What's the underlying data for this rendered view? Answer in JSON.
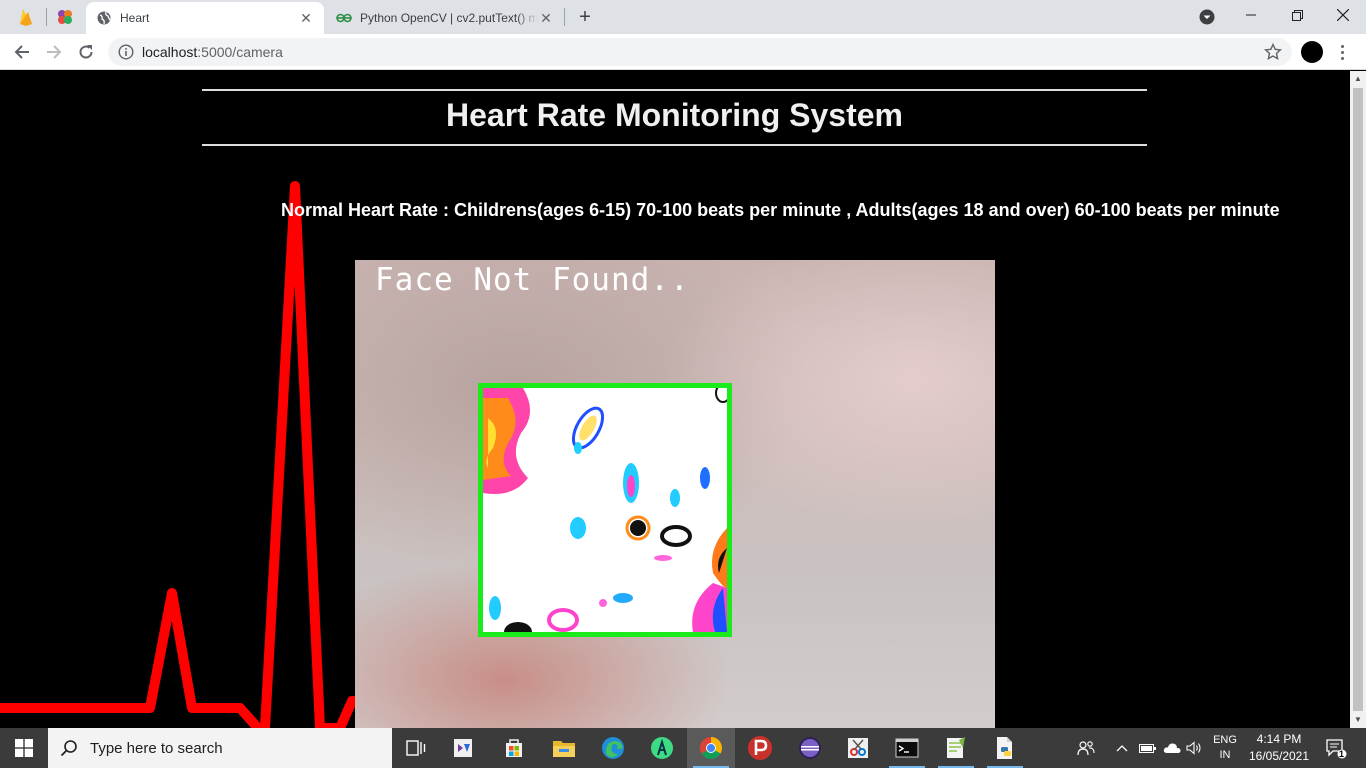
{
  "browser": {
    "tabs": [
      {
        "title": "Heart",
        "active": true
      },
      {
        "title": "Python OpenCV | cv2.putText() m",
        "active": false
      }
    ],
    "address": {
      "host": "localhost",
      "path": ":5000/camera"
    },
    "new_tab_symbol": "+",
    "icons": [
      "back-icon",
      "forward-icon",
      "reload-icon",
      "info-icon",
      "star-icon",
      "menu-icon"
    ]
  },
  "page": {
    "title": "Heart Rate Monitoring System",
    "normal_rate": "Normal Heart Rate : Childrens(ages 6-15) 70-100 beats per minute , Adults(ages 18 and over) 60-100 beats per minute",
    "video_overlay": "Face Not Found..",
    "colors": {
      "ecg": "#ff0000",
      "roi_border": "#1bea1b",
      "background": "#000000"
    }
  },
  "taskbar": {
    "search_placeholder": "Type here to search",
    "lang_top": "ENG",
    "lang_bottom": "IN",
    "time": "4:14 PM",
    "date": "16/05/2021",
    "notification_count": "1"
  }
}
